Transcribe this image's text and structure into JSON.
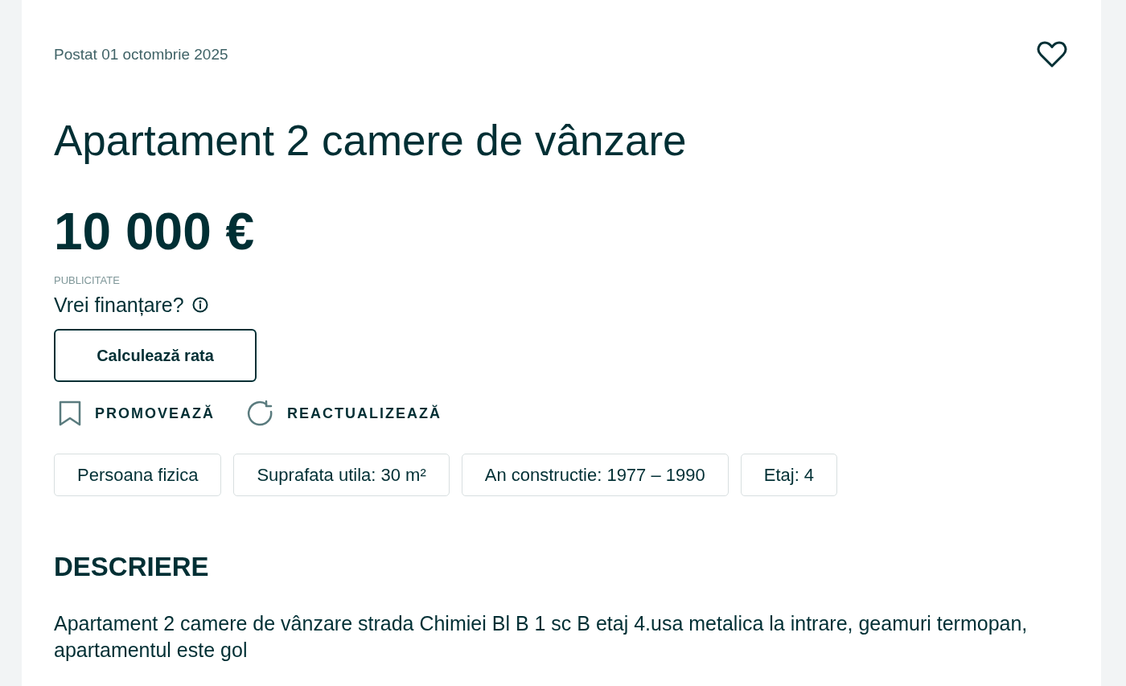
{
  "posted": "Postat 01 octombrie 2025",
  "title": "Apartament 2 camere de vânzare",
  "price": "10 000 €",
  "financing": {
    "label": "PUBLICITATE",
    "question": "Vrei finanțare?",
    "button": "Calculează rata"
  },
  "actions": [
    {
      "kind": "promote",
      "label": "PROMOVEAZĂ"
    },
    {
      "kind": "refresh",
      "label": "REACTUALIZEAZĂ"
    }
  ],
  "tags": [
    "Persoana fizica",
    "Suprafata utila: 30 m²",
    "An constructie: 1977 – 1990",
    "Etaj: 4"
  ],
  "description": {
    "heading": "DESCRIERE",
    "text": "Apartament 2 camere de vânzare strada Chimiei Bl B 1 sc B etaj 4.usa metalica la intrare, geamuri termopan, apartamentul este gol"
  }
}
